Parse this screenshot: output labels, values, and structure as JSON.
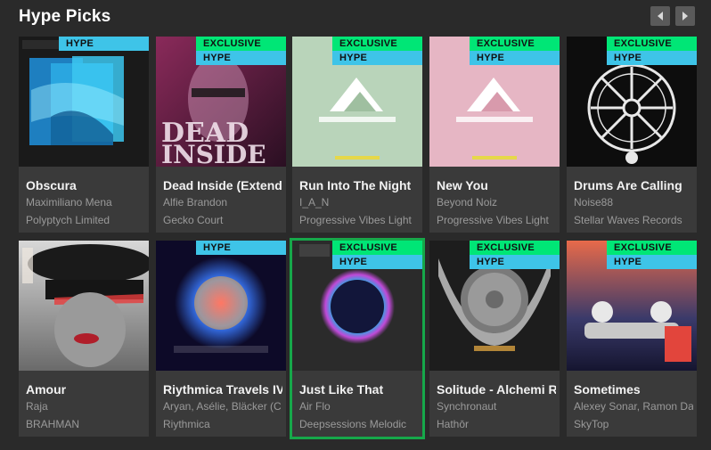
{
  "section": {
    "title": "Hype Picks"
  },
  "nav": {
    "prev_icon": "chevron-left-icon",
    "next_icon": "chevron-right-icon"
  },
  "badges": {
    "exclusive": "EXCLUSIVE",
    "hype": "HYPE"
  },
  "colors": {
    "exclusive": "#00e676",
    "hype": "#3ec4e8",
    "selected_outline": "#16a84a"
  },
  "releases": [
    {
      "title": "Obscura",
      "artist": "Maximiliano Mena",
      "label": "Polyptych Limited",
      "exclusive": false,
      "hype": true
    },
    {
      "title": "Dead Inside (Extended Mix)",
      "artist": "Alfie Brandon",
      "label": "Gecko Court",
      "exclusive": true,
      "hype": true
    },
    {
      "title": "Run Into The Night",
      "artist": "I_A_N",
      "label": "Progressive Vibes Light",
      "exclusive": true,
      "hype": true
    },
    {
      "title": "New You",
      "artist": "Beyond Noiz",
      "label": "Progressive Vibes Light",
      "exclusive": true,
      "hype": true
    },
    {
      "title": "Drums Are Calling",
      "artist": "Noise88",
      "label": "Stellar Waves Records",
      "exclusive": true,
      "hype": true
    },
    {
      "title": "Amour",
      "artist": "Raja",
      "label": "BRAHMAN",
      "exclusive": false,
      "hype": false
    },
    {
      "title": "Riythmica Travels IV:",
      "artist": "Aryan, Asélie, Bläcker (C",
      "label": "Riythmica",
      "exclusive": false,
      "hype": true
    },
    {
      "title": "Just Like That",
      "artist": "Air Flo",
      "label": "Deepsessions Melodic",
      "exclusive": true,
      "hype": true,
      "selected": true
    },
    {
      "title": "Solitude - Alchemi R",
      "artist": "Synchronaut",
      "label": "Hathōr",
      "exclusive": true,
      "hype": true
    },
    {
      "title": "Sometimes",
      "artist": "Alexey Sonar, Ramon Da",
      "label": "SkyTop",
      "exclusive": true,
      "hype": true
    }
  ]
}
